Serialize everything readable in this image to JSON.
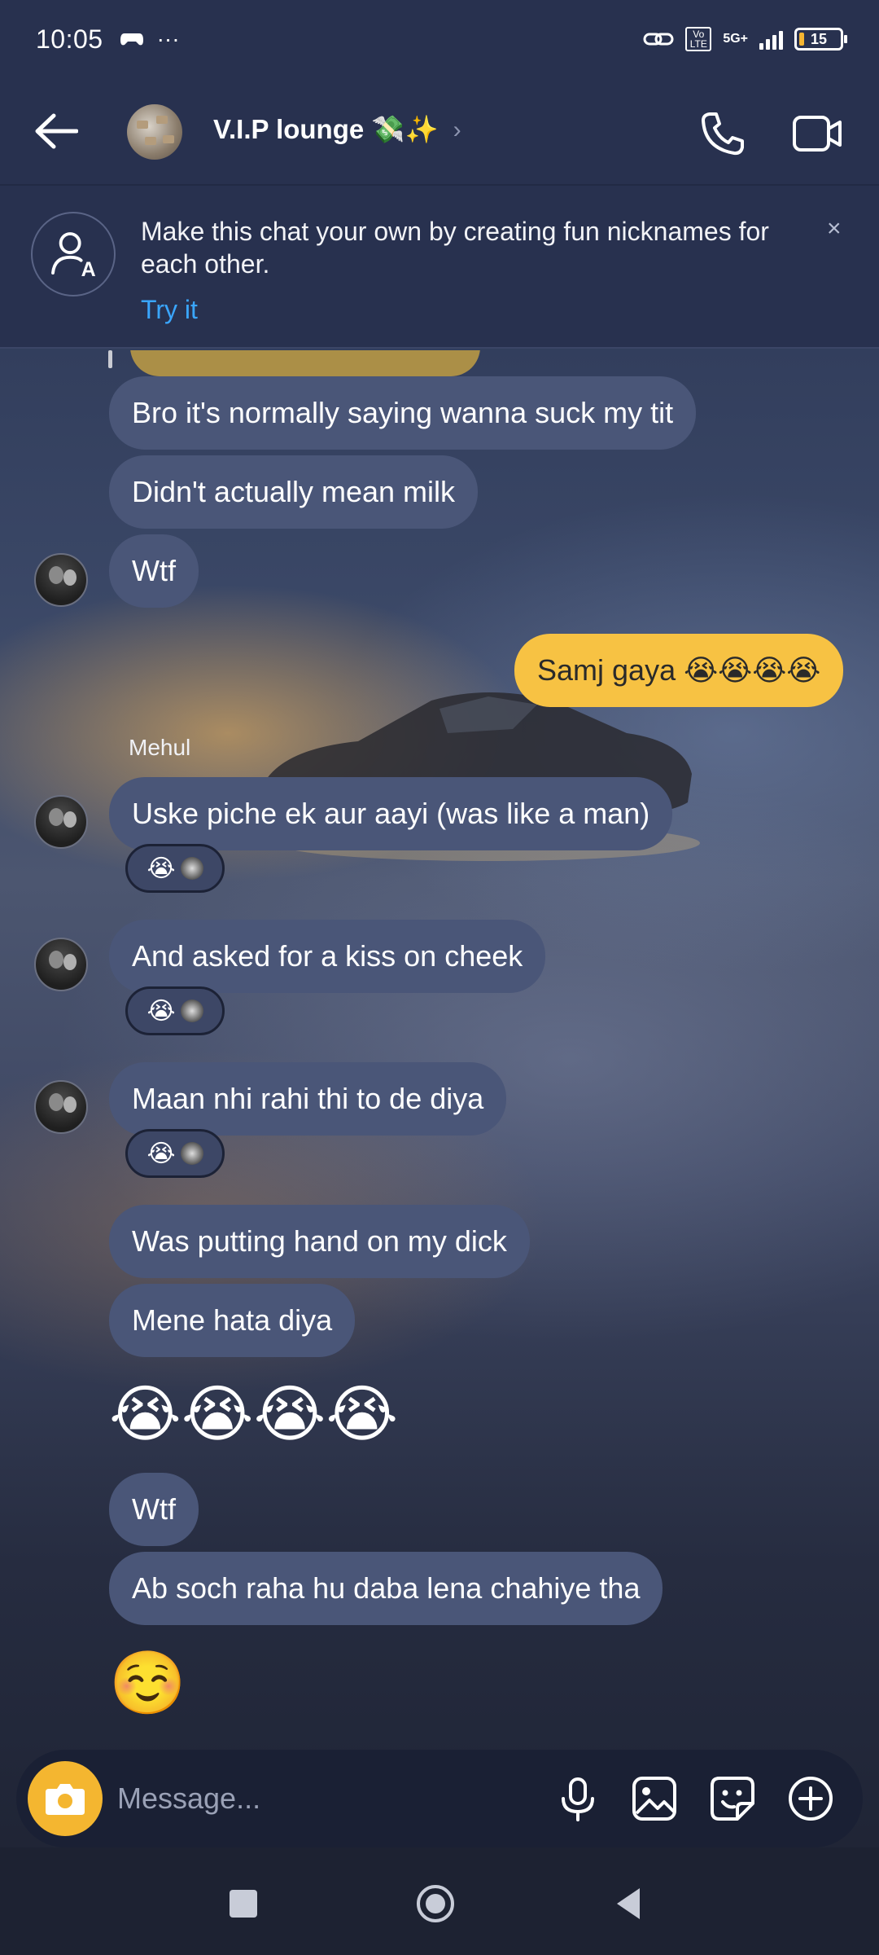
{
  "status_bar": {
    "time": "10:05",
    "extra": "···",
    "network": "5G+",
    "volte": "Vo LTE",
    "battery": "15"
  },
  "header": {
    "title": "V.I.P lounge 💸✨",
    "chevron": "›"
  },
  "banner": {
    "text": "Make this chat your own by creating fun nicknames for each other.",
    "action": "Try it",
    "close": "×"
  },
  "messages": {
    "m1": "Bro it's normally saying wanna suck my tit",
    "m2": "Didn't actually mean milk",
    "m3": "Wtf",
    "m4": "Samj gaya 😭😭😭😭",
    "sender": "Mehul",
    "m5": "Uske piche ek aur aayi (was like a man)",
    "m6": "And asked for a kiss on cheek",
    "m7": "Maan nhi rahi thi to de diya",
    "m8": "Was putting hand on my dick",
    "m9": "Mene hata diya",
    "m10": "😭😭😭😭",
    "m11": "Wtf",
    "m12": "Ab soch raha hu daba lena chahiye tha",
    "m13": "☺️",
    "reaction_emoji": "😭"
  },
  "composer": {
    "placeholder": "Message..."
  },
  "colors": {
    "outgoing_bubble": "#f7c243",
    "incoming_bubble": "#4a5678",
    "accent_link": "#3aa6ff",
    "camera_button": "#f4b630"
  },
  "icons": [
    "back-arrow-icon",
    "phone-icon",
    "video-camera-icon",
    "nickname-icon",
    "close-icon",
    "camera-icon",
    "microphone-icon",
    "gallery-icon",
    "sticker-icon",
    "plus-icon",
    "recents-icon",
    "home-icon",
    "back-icon"
  ]
}
